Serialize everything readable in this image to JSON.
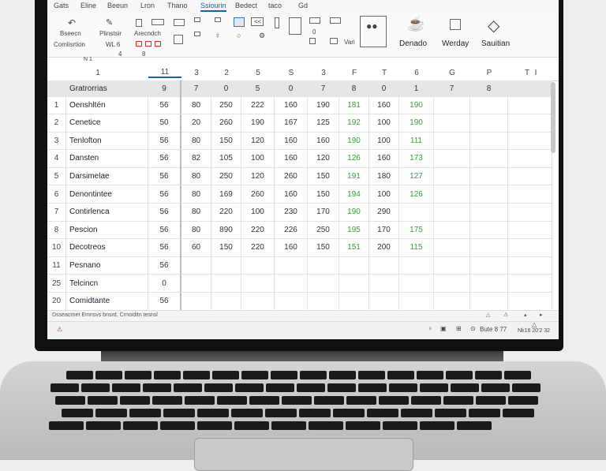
{
  "menu": {
    "tabs": [
      "Gats",
      "Eline",
      "Beeun",
      "Lron",
      "Thano",
      "Ssiourin",
      "Bedect",
      "taco",
      "Gd"
    ],
    "active": "Ssiourin"
  },
  "ribbon": {
    "g1": [
      "Bseecn",
      "Comlisrtion"
    ],
    "g2": [
      "Plinstsir",
      "WL 6",
      "4"
    ],
    "g3": [
      "Arecndch",
      "8"
    ],
    "g4": [
      "Vari"
    ],
    "big": [
      "Denado",
      "Werday",
      "Sauitian"
    ],
    "misc": [
      "<<",
      "0",
      "N 1"
    ]
  },
  "namebox": "N 1",
  "columns": [
    "1",
    "11",
    "3",
    "2",
    "5",
    "S",
    "3",
    "F",
    "T",
    "6",
    "G",
    "P",
    "T",
    "I"
  ],
  "header_row": {
    "label": "Gratrorrias",
    "values": [
      "9",
      "7",
      "0",
      "5",
      "0",
      "7",
      "8",
      "0",
      "1",
      "7",
      "8"
    ]
  },
  "rows": [
    {
      "num": "1",
      "name": "Oenshltén",
      "code": "56",
      "vals": [
        "80",
        "250",
        "222",
        "160",
        "190",
        "181",
        "160",
        "190"
      ]
    },
    {
      "num": "2",
      "name": "Cenetice",
      "code": "50",
      "vals": [
        "20",
        "260",
        "190",
        "167",
        "125",
        "192",
        "100",
        "190"
      ]
    },
    {
      "num": "3",
      "name": "Tenlofton",
      "code": "56",
      "vals": [
        "80",
        "150",
        "120",
        "160",
        "160",
        "190",
        "100",
        "111"
      ]
    },
    {
      "num": "4",
      "name": "Dansten",
      "code": "56",
      "vals": [
        "82",
        "105",
        "100",
        "160",
        "120",
        "126",
        "160",
        "173"
      ]
    },
    {
      "num": "5",
      "name": "Darsimelae",
      "code": "56",
      "vals": [
        "80",
        "250",
        "120",
        "260",
        "150",
        "191",
        "180",
        "127"
      ]
    },
    {
      "num": "6",
      "name": "Denontintee",
      "code": "56",
      "vals": [
        "80",
        "169",
        "260",
        "160",
        "150",
        "194",
        "100",
        "126"
      ]
    },
    {
      "num": "7",
      "name": "Contirlenca",
      "code": "56",
      "vals": [
        "80",
        "220",
        "100",
        "230",
        "170",
        "190",
        "290",
        ""
      ]
    },
    {
      "num": "8",
      "name": "Pescion",
      "code": "56",
      "vals": [
        "80",
        "890",
        "220",
        "226",
        "250",
        "195",
        "170",
        "175"
      ]
    },
    {
      "num": "10",
      "name": "Decotreos",
      "code": "56",
      "vals": [
        "60",
        "150",
        "220",
        "160",
        "150",
        "151",
        "200",
        "115"
      ]
    },
    {
      "num": "11",
      "name": "Pesnano",
      "code": "56",
      "vals": [
        "",
        "",
        "",
        "",
        "",
        "",
        "",
        ""
      ]
    },
    {
      "num": "25",
      "name": "Telcincn",
      "code": "0",
      "vals": [
        "",
        "",
        "",
        "",
        "",
        "",
        "",
        ""
      ]
    },
    {
      "num": "20",
      "name": "Comidtante",
      "code": "56",
      "vals": [
        "",
        "",
        "",
        "",
        "",
        "",
        "",
        ""
      ]
    }
  ],
  "hscroll_text": "Dsseacrnet  Emnsvs  bnsrd,  Crnoiditn  tesnsl",
  "status": {
    "left": "⚠",
    "right": "Bute  8 77",
    "clock": "Nk16 20'2  32"
  },
  "colors": {
    "accent": "#1a5fb4",
    "green": "#3b9a3b",
    "header_bg": "#e6e6e6"
  }
}
